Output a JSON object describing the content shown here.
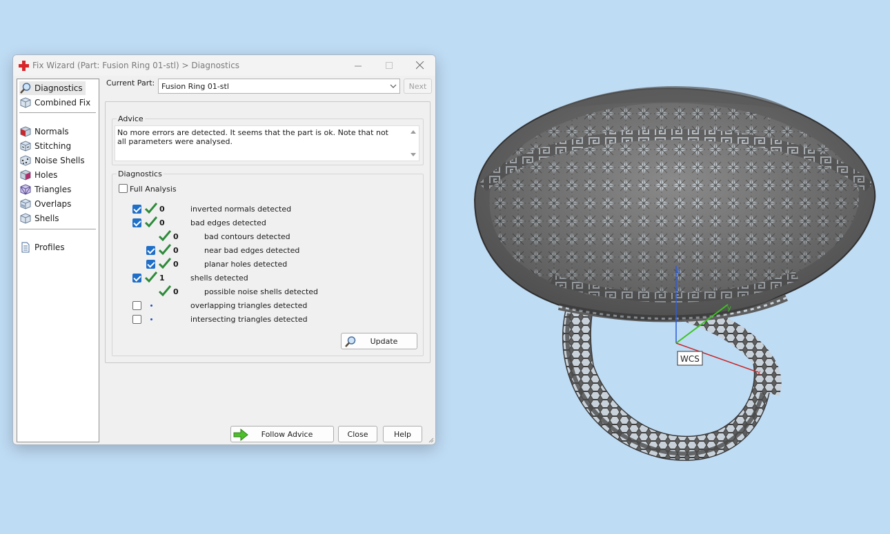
{
  "window": {
    "title": "Fix Wizard (Part: Fusion Ring 01-stl) > Diagnostics"
  },
  "sidebar": {
    "items": [
      {
        "label": "Diagnostics",
        "icon": "magnifier-icon"
      },
      {
        "label": "Combined Fix",
        "icon": "cube-icon"
      },
      {
        "label": "Normals",
        "icon": "normals-cube-icon"
      },
      {
        "label": "Stitching",
        "icon": "stitching-cube-icon"
      },
      {
        "label": "Noise Shells",
        "icon": "noise-shells-icon"
      },
      {
        "label": "Holes",
        "icon": "holes-cube-icon"
      },
      {
        "label": "Triangles",
        "icon": "triangles-cube-icon"
      },
      {
        "label": "Overlaps",
        "icon": "overlaps-cube-icon"
      },
      {
        "label": "Shells",
        "icon": "shells-cube-icon"
      },
      {
        "label": "Profiles",
        "icon": "document-icon"
      }
    ]
  },
  "current_part": {
    "label": "Current Part:",
    "value": "Fusion Ring 01-stl",
    "next_label": "Next"
  },
  "advice": {
    "title": "Advice",
    "text": "No more errors are detected. It seems that the part is ok. Note that not all parameters were analysed."
  },
  "diagnostics": {
    "title": "Diagnostics",
    "full_analysis_label": "Full Analysis",
    "rows": [
      {
        "value": "0",
        "text": "inverted normals detected"
      },
      {
        "value": "0",
        "text": "bad edges detected"
      },
      {
        "value": "0",
        "text": "bad contours detected"
      },
      {
        "value": "0",
        "text": "near bad edges detected"
      },
      {
        "value": "0",
        "text": "planar holes detected"
      },
      {
        "value": "1",
        "text": "shells detected"
      },
      {
        "value": "0",
        "text": "possible noise shells detected"
      },
      {
        "value": "",
        "text": "overlapping triangles detected"
      },
      {
        "value": "",
        "text": "intersecting triangles detected"
      }
    ],
    "update_label": "Update"
  },
  "footer": {
    "follow_advice_label": "Follow Advice",
    "close_label": "Close",
    "help_label": "Help"
  },
  "viewport": {
    "wcs_label": "WCS",
    "axis_z": "z",
    "axis_x": "x",
    "axis_y": "y"
  }
}
